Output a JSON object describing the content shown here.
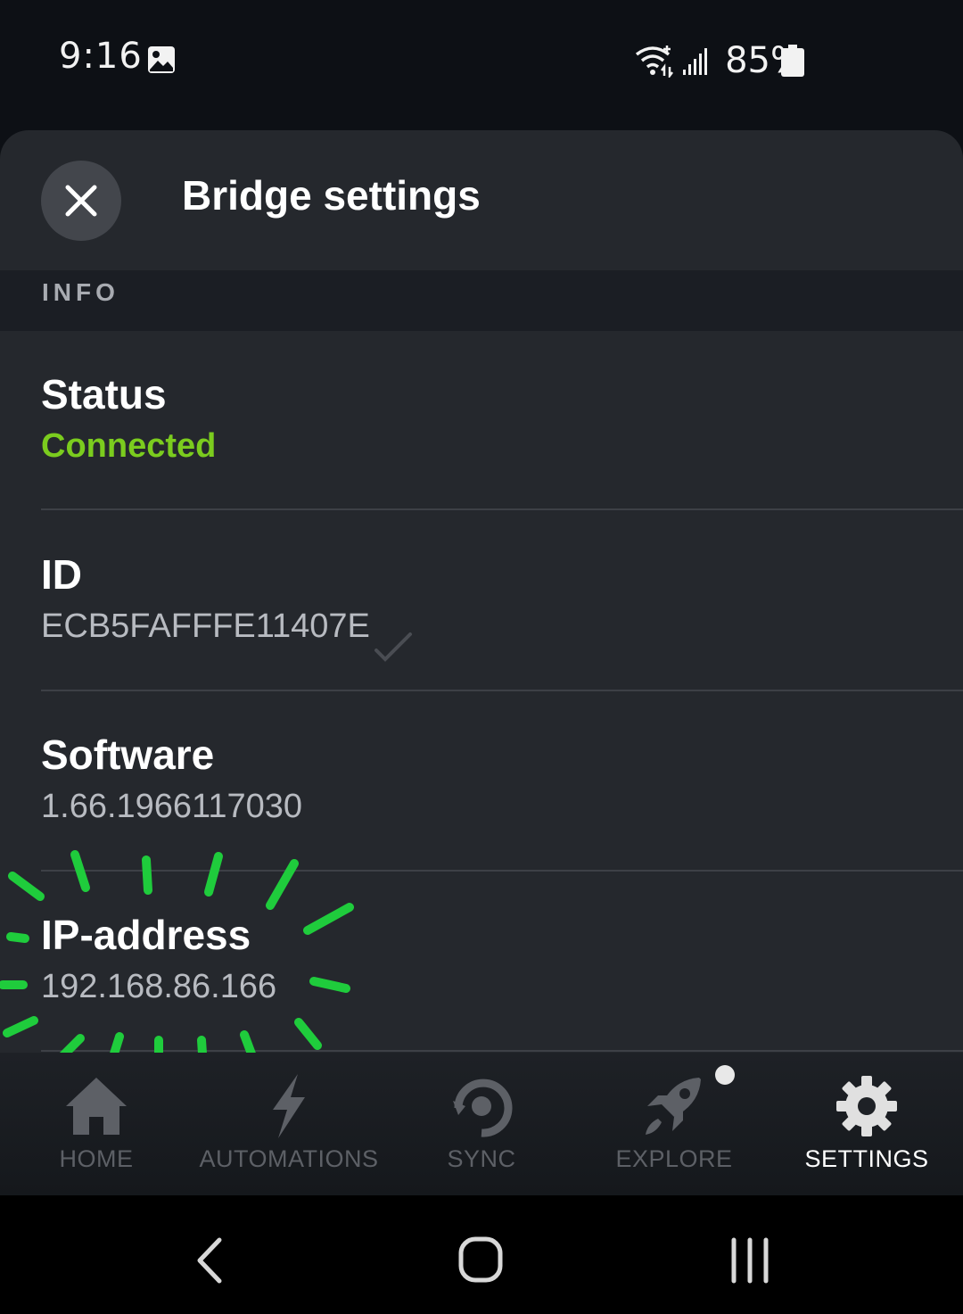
{
  "status_bar": {
    "time": "9:16",
    "battery": "85%"
  },
  "sheet": {
    "title": "Bridge settings",
    "section_label": "INFO",
    "rows": [
      {
        "label": "Status",
        "value": "Connected"
      },
      {
        "label": "ID",
        "value": "ECB5FAFFFE11407E"
      },
      {
        "label": "Software",
        "value": "1.66.1966117030"
      },
      {
        "label": "IP-address",
        "value": "192.168.86.166"
      }
    ]
  },
  "nav": {
    "items": [
      {
        "label": "HOME",
        "icon": "home-icon"
      },
      {
        "label": "AUTOMATIONS",
        "icon": "lightning-icon"
      },
      {
        "label": "SYNC",
        "icon": "sync-icon"
      },
      {
        "label": "EXPLORE",
        "icon": "rocket-icon"
      },
      {
        "label": "SETTINGS",
        "icon": "gear-icon"
      }
    ],
    "active": "SETTINGS"
  },
  "colors": {
    "connected": "#7bcc1e",
    "annotation": "#1fcc3c",
    "background": "#25282d",
    "section": "#1b1e24"
  }
}
